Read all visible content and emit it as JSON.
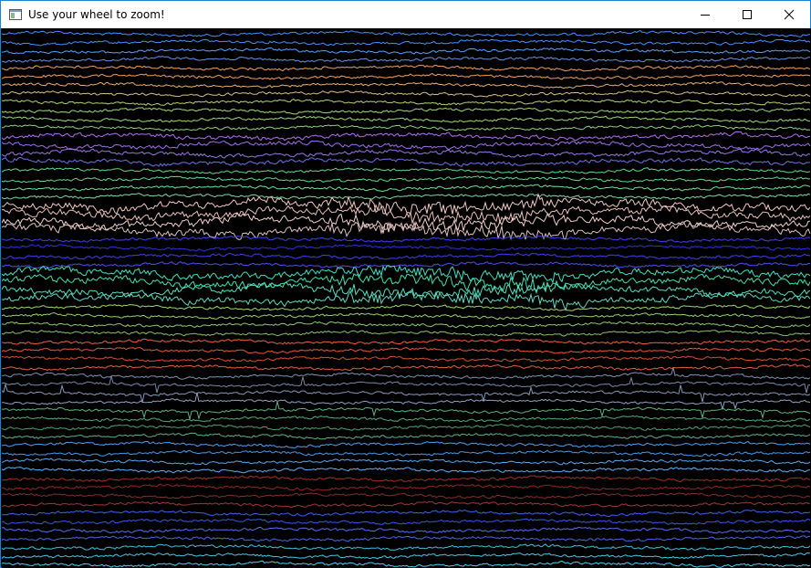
{
  "window": {
    "title": "Use your wheel to zoom!",
    "icon": "app-window-icon",
    "controls": {
      "minimize": "minimize-icon",
      "maximize": "maximize-icon",
      "close": "close-icon"
    }
  },
  "plot": {
    "background": "#000000",
    "description_type": "multi-channel signal traces",
    "channel_colors": [
      "#4a90ff",
      "#4a90ff",
      "#5aa0ff",
      "#6b8ee6",
      "#f0a060",
      "#f0a060",
      "#e8b070",
      "#d8c080",
      "#b8d070",
      "#a0d878",
      "#a0d878",
      "#90d080",
      "#b070f0",
      "#a070f0",
      "#9878e8",
      "#7070e8",
      "#60d890",
      "#60d890",
      "#70e098",
      "#80d8a0",
      "#f0c8c0",
      "#e8c0b8",
      "#f0d0c8",
      "#e0c0c0",
      "#4040f0",
      "#3030e0",
      "#4040f0",
      "#5050f0",
      "#40e0c0",
      "#40e0b0",
      "#50e0c0",
      "#60d8c0",
      "#a0d870",
      "#98d070",
      "#90c870",
      "#88c070",
      "#f06040",
      "#e85838",
      "#d85030",
      "#e06040",
      "#8090b0",
      "#7888a8",
      "#8898b8",
      "#90a0c0",
      "#60b080",
      "#58a878",
      "#50a070",
      "#60b088",
      "#50a0f0",
      "#4898e8",
      "#58a8f0",
      "#60b0f8",
      "#a03030",
      "#902828",
      "#803030",
      "#a03838",
      "#4060f0",
      "#3858e8",
      "#5070f0",
      "#4868e8",
      "#40c0e0",
      "#48c8e8",
      "#50d0f0"
    ]
  }
}
